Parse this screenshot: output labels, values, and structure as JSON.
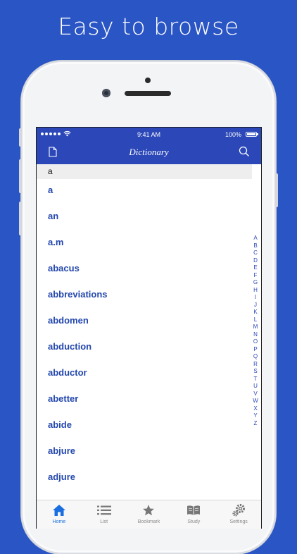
{
  "headline": "Easy to browse",
  "status_bar": {
    "time": "9:41 AM",
    "battery": "100%"
  },
  "nav": {
    "title": "Dictionary",
    "left_icon": "document-icon",
    "right_icon": "search-icon"
  },
  "section_header": "a",
  "entries": [
    "a",
    "an",
    "a.m",
    "abacus",
    "abbreviations",
    "abdomen",
    "abduction",
    "abductor",
    "abetter",
    "abide",
    "abjure",
    "adjure"
  ],
  "alpha_index": [
    "A",
    "B",
    "C",
    "D",
    "E",
    "F",
    "G",
    "H",
    "I",
    "J",
    "K",
    "L",
    "M",
    "N",
    "O",
    "P",
    "Q",
    "R",
    "S",
    "T",
    "U",
    "V",
    "W",
    "X",
    "Y",
    "Z"
  ],
  "tabs": [
    {
      "label": "Home",
      "icon": "home-icon",
      "active": true
    },
    {
      "label": "List",
      "icon": "list-icon",
      "active": false
    },
    {
      "label": "Bookmark",
      "icon": "star-icon",
      "active": false
    },
    {
      "label": "Study",
      "icon": "book-icon",
      "active": false
    },
    {
      "label": "Settings",
      "icon": "gear-icon",
      "active": false
    }
  ],
  "colors": {
    "background": "#2a55c4",
    "nav_bar": "#2b47b8",
    "entry_text": "#2347ad",
    "active_tab": "#1a6fe0"
  }
}
